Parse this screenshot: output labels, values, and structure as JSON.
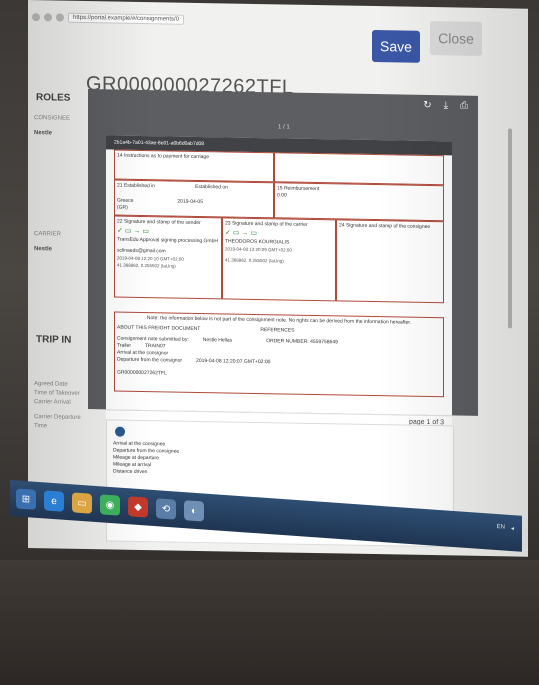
{
  "browser": {
    "url": "https://portal.example/#/consignments/0"
  },
  "header": {
    "title": "GR000000027262TFL",
    "save_label": "Save",
    "close_label": "Close"
  },
  "sidebar": {
    "roles_heading": "ROLES",
    "trip_heading": "TRIP IN",
    "items": [
      "CONSIGNEE",
      "Nestle",
      "CARRIER",
      "Nestle"
    ],
    "trip_labels": [
      "Agreed Date",
      "Time of Takeover",
      "Carrier Arrival",
      "Carrier Departure",
      "Time"
    ]
  },
  "viewer": {
    "doc_id": "2b1a4b-7a01-43ae-8e01-a0b6d0ab7d08",
    "pager": "1 / 1",
    "page_footer": "page 1 of 3",
    "icons": [
      "refresh-icon",
      "download-icon",
      "print-icon"
    ]
  },
  "document": {
    "section14": "14 Instructions as to payment for carriage",
    "section21_label": "21 Established in",
    "section21_on": "Established on",
    "section21_place": "Greece\n(GR)",
    "section21_date": "2019-04-05",
    "section15": "15 Reimbursement",
    "section15_val": "0.00",
    "section22": "22 Signature and stamp of the sender",
    "section22_text": "TransEdu Approval signing processing GmbH",
    "section22_email": "sclinaeds@gmail.com",
    "section22_time": "2019-04-08 12:20:10 GMT+02:00",
    "section22_coords": "41.368862, 0.255502 (lat,lng)",
    "section23": "23 Signature and stamp of the carrier",
    "section23_name": "THEODOROS KOURGIALIS",
    "section23_time": "2019-04-08 12:20:09 GMT+02:00",
    "section23_coords": "41.368862, 0.255502 (lat,lng)",
    "section24": "24 Signature and stamp of the consignee",
    "note": "Note: the information below is not part of the consignment note. No rights can be derived from the information hereafter.",
    "about": "ABOUT THIS FREIGHT DOCUMENT",
    "references": "REFERENCES",
    "submitted_by": "Consignment note submitted by:",
    "submitted_val": "Nestle Hellas",
    "trailer_label": "Trailer",
    "trailer_val": "TRAIN07",
    "arrival": "Arrival at the consignor",
    "departure": "Departure from the consignor",
    "departure_val": "2019-04-08 12:20:07 GMT+02:00",
    "order_number": "ORDER NUMBER: 4559758649",
    "doc_code": "GR000000027262TFL"
  },
  "page2": {
    "rows": [
      "Arrival at the consignee",
      "Departure from the consignee",
      "Mileage at departure",
      "Mileage at arrival",
      "Distance driven"
    ]
  },
  "taskbar": {
    "tray_text": "EN"
  }
}
